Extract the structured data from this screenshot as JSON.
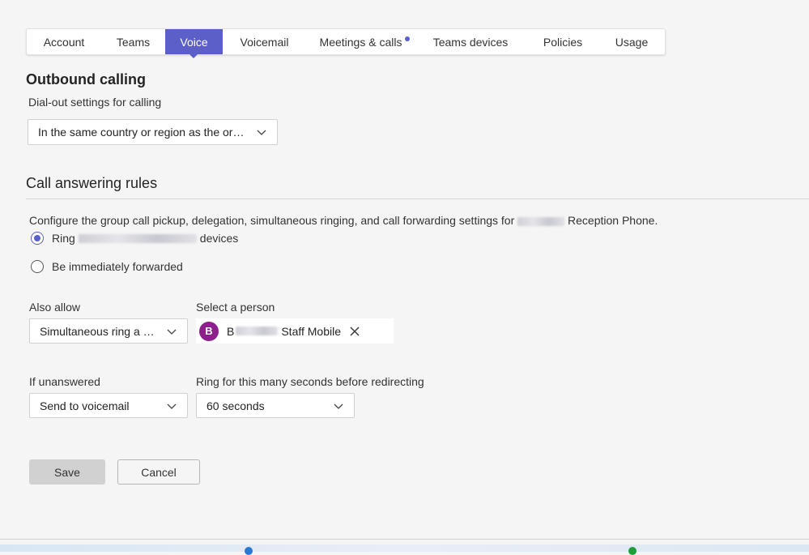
{
  "tabs": [
    {
      "label": "Account",
      "active": false,
      "dot": false
    },
    {
      "label": "Teams",
      "active": false,
      "dot": false
    },
    {
      "label": "Voice",
      "active": true,
      "dot": false
    },
    {
      "label": "Voicemail",
      "active": false,
      "dot": false
    },
    {
      "label": "Meetings & calls",
      "active": false,
      "dot": true
    },
    {
      "label": "Teams devices",
      "active": false,
      "dot": false
    },
    {
      "label": "Policies",
      "active": false,
      "dot": false
    },
    {
      "label": "Usage",
      "active": false,
      "dot": false
    }
  ],
  "outbound": {
    "title": "Outbound calling",
    "subtitle": "Dial-out settings for calling",
    "dial_out_value": "In the same country or region as the orga..."
  },
  "call_answering": {
    "title": "Call answering rules",
    "description_prefix": "Configure the group call pickup, delegation, simultaneous ringing, and call forwarding settings for",
    "description_suffix": "Reception Phone.",
    "radio_ring_prefix": "Ring",
    "radio_ring_suffix": "devices",
    "radio_forward": "Be immediately forwarded",
    "also_allow_label": "Also allow",
    "also_allow_value": "Simultaneous ring a user",
    "select_person_label": "Select a person",
    "person_initial": "B",
    "person_name_prefix": "B",
    "person_name_suffix": "Staff Mobile",
    "if_unanswered_label": "If unanswered",
    "if_unanswered_value": "Send to voicemail",
    "ring_seconds_label": "Ring for this many seconds before redirecting",
    "ring_seconds_value": "60 seconds"
  },
  "buttons": {
    "save": "Save",
    "cancel": "Cancel"
  },
  "colors": {
    "accent": "#5b5fc7",
    "avatar": "#8c1f8c"
  },
  "icons": {
    "chevron": "chevron-down-icon",
    "remove": "close-icon"
  }
}
